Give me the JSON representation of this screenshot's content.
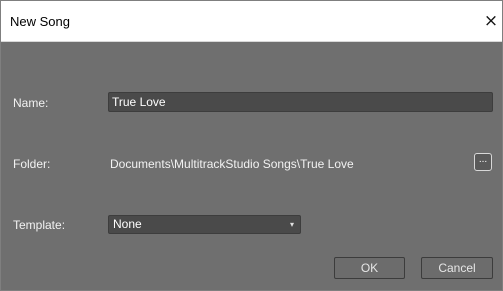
{
  "window": {
    "title": "New Song",
    "close_icon": "×"
  },
  "form": {
    "name_label": "Name:",
    "name_value": "True Love",
    "folder_label": "Folder:",
    "folder_path": "Documents\\MultitrackStudio Songs\\True Love",
    "browse_label": "...",
    "template_label": "Template:",
    "template_value": "None",
    "dropdown_icon": "▾"
  },
  "buttons": {
    "ok": "OK",
    "cancel": "Cancel"
  }
}
